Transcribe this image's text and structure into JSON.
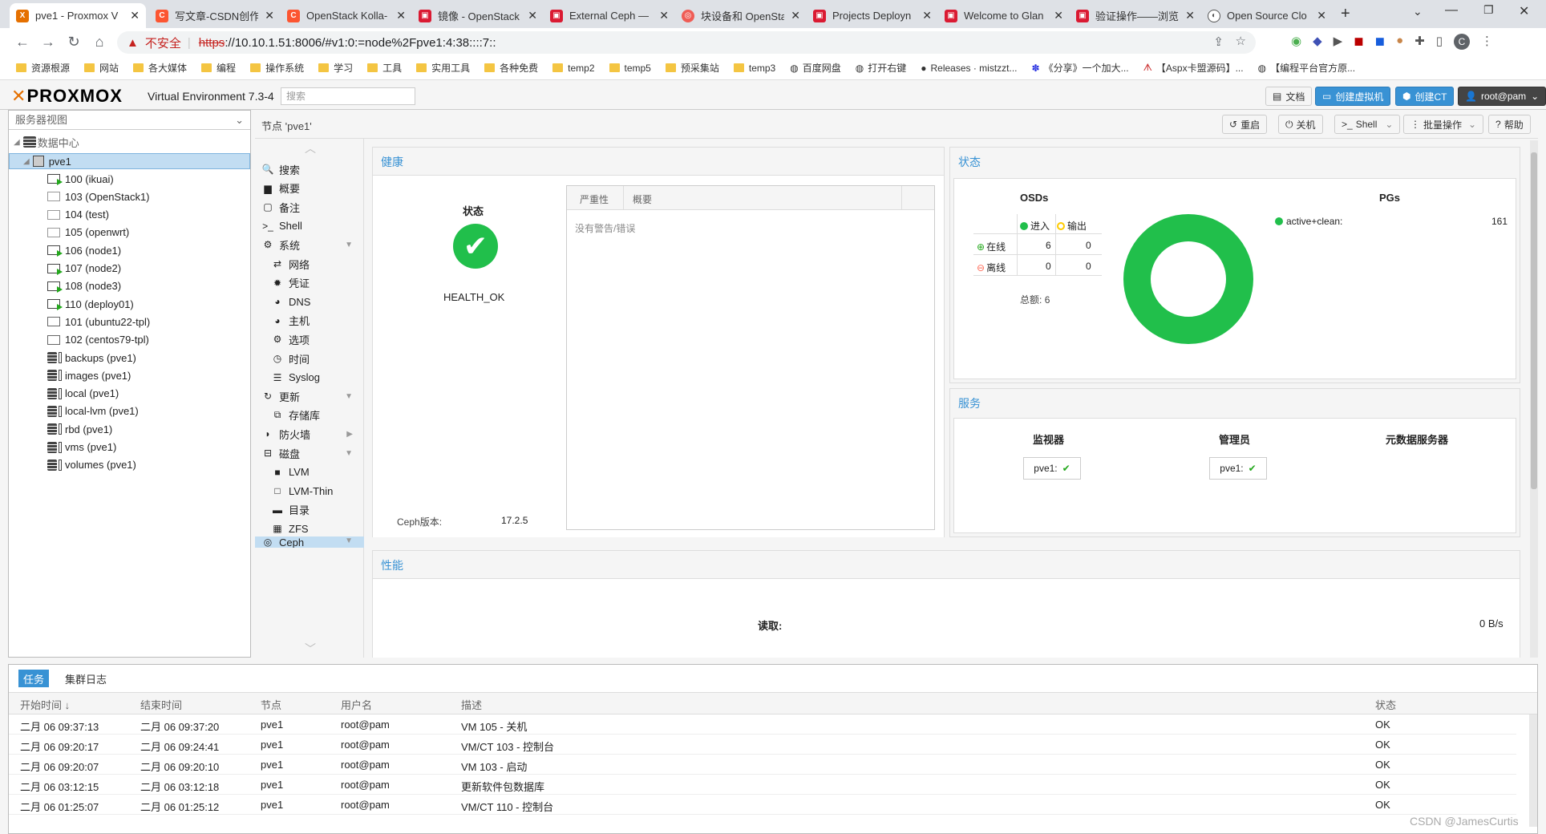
{
  "browser": {
    "tabs": [
      {
        "title": "pve1 - Proxmox V",
        "active": true,
        "icon": "proxmox-icon"
      },
      {
        "title": "写文章-CSDN创作",
        "active": false,
        "icon": "csdn-icon"
      },
      {
        "title": "OpenStack Kolla-",
        "active": false,
        "icon": "csdn-icon"
      },
      {
        "title": "镜像 - OpenStack",
        "active": false,
        "icon": "openstack-icon"
      },
      {
        "title": "External Ceph —",
        "active": false,
        "icon": "openstack-icon"
      },
      {
        "title": "块设备和 OpenSta",
        "active": false,
        "icon": "ceph-icon"
      },
      {
        "title": "Projects Deployn",
        "active": false,
        "icon": "openstack-icon"
      },
      {
        "title": "Welcome to Glan",
        "active": false,
        "icon": "openstack-icon"
      },
      {
        "title": "验证操作——浏览",
        "active": false,
        "icon": "openstack-icon"
      },
      {
        "title": "Open Source Clo",
        "active": false,
        "icon": "globe-icon"
      }
    ],
    "insecure_label": "不安全",
    "url_scheme": "https",
    "url_rest": "://10.10.1.51:8006/#v1:0:=node%2Fpve1:4:38::::7::",
    "bookmarks": [
      "资源根源",
      "网站",
      "各大媒体",
      "编程",
      "操作系统",
      "学习",
      "工具",
      "实用工具",
      "各种免费",
      "temp2",
      "temp5",
      "预采集站",
      "temp3",
      "百度网盘",
      "打开右键",
      "Releases · mistzzt...",
      "《分享》一个加大...",
      "【Aspx卡盟源码】...",
      "【编程平台官方原..."
    ]
  },
  "pve": {
    "logo": "PROXMOX",
    "version": "Virtual Environment 7.3-4",
    "search_placeholder": "搜索",
    "docs": "文档",
    "create_vm": "创建虚拟机",
    "create_ct": "创建CT",
    "user": "root@pam"
  },
  "tree": {
    "view": "服务器视图",
    "datacenter": "数据中心",
    "node": "pve1",
    "items": [
      {
        "label": "100 (ikuai)",
        "kind": "run"
      },
      {
        "label": "103 (OpenStack1)",
        "kind": "off"
      },
      {
        "label": "104 (test)",
        "kind": "off"
      },
      {
        "label": "105 (openwrt)",
        "kind": "off"
      },
      {
        "label": "106 (node1)",
        "kind": "run"
      },
      {
        "label": "107 (node2)",
        "kind": "run"
      },
      {
        "label": "108 (node3)",
        "kind": "run"
      },
      {
        "label": "110 (deploy01)",
        "kind": "run"
      },
      {
        "label": "101 (ubuntu22-tpl)",
        "kind": "tpl"
      },
      {
        "label": "102 (centos79-tpl)",
        "kind": "tpl"
      },
      {
        "label": "backups (pve1)",
        "kind": "stor"
      },
      {
        "label": "images (pve1)",
        "kind": "stor"
      },
      {
        "label": "local (pve1)",
        "kind": "stor"
      },
      {
        "label": "local-lvm (pve1)",
        "kind": "stor"
      },
      {
        "label": "rbd (pve1)",
        "kind": "stor"
      },
      {
        "label": "vms (pve1)",
        "kind": "stor"
      },
      {
        "label": "volumes (pve1)",
        "kind": "stor"
      }
    ]
  },
  "content": {
    "breadcrumb": "节点 'pve1'",
    "reboot": "重启",
    "shutdown": "关机",
    "shell": "Shell",
    "bulk": "批量操作",
    "help": "帮助"
  },
  "nav": [
    {
      "label": "搜索",
      "icon": "search-icon",
      "indent": false
    },
    {
      "label": "概要",
      "icon": "book-icon",
      "indent": false
    },
    {
      "label": "备注",
      "icon": "note-icon",
      "indent": false
    },
    {
      "label": "Shell",
      "icon": "terminal-icon",
      "indent": false
    },
    {
      "label": "系统",
      "icon": "gears-icon",
      "indent": false,
      "arrow": "down"
    },
    {
      "label": "网络",
      "icon": "network-icon",
      "indent": true
    },
    {
      "label": "凭证",
      "icon": "certificate-icon",
      "indent": true
    },
    {
      "label": "DNS",
      "icon": "globe-icon",
      "indent": true
    },
    {
      "label": "主机",
      "icon": "globe-icon",
      "indent": true
    },
    {
      "label": "选项",
      "icon": "gear-icon",
      "indent": true
    },
    {
      "label": "时间",
      "icon": "clock-icon",
      "indent": true
    },
    {
      "label": "Syslog",
      "icon": "list-icon",
      "indent": true
    },
    {
      "label": "更新",
      "icon": "refresh-icon",
      "indent": false,
      "arrow": "down"
    },
    {
      "label": "存储库",
      "icon": "files-icon",
      "indent": true
    },
    {
      "label": "防火墙",
      "icon": "shield-icon",
      "indent": false,
      "arrow": "right"
    },
    {
      "label": "磁盘",
      "icon": "hdd-icon",
      "indent": false,
      "arrow": "down"
    },
    {
      "label": "LVM",
      "icon": "square-icon",
      "indent": true
    },
    {
      "label": "LVM-Thin",
      "icon": "square-outline-icon",
      "indent": true
    },
    {
      "label": "目录",
      "icon": "folder-icon",
      "indent": true
    },
    {
      "label": "ZFS",
      "icon": "th-large-icon",
      "indent": true
    },
    {
      "label": "Ceph",
      "icon": "ceph-icon",
      "indent": false,
      "arrow": "down"
    }
  ],
  "health": {
    "title": "健康",
    "status_label": "状态",
    "status": "HEALTH_OK",
    "ceph_version_label": "Ceph版本:",
    "ceph_version": "17.2.5",
    "col_severity": "严重性",
    "col_summary": "概要",
    "empty": "没有警告/错误"
  },
  "status": {
    "title": "状态",
    "osds_title": "OSDs",
    "in_label": "进入",
    "out_label": "输出",
    "up_label": "在线",
    "down_label": "离线",
    "up_in": "6",
    "up_out": "0",
    "down_in": "0",
    "down_out": "0",
    "total_label": "总额:",
    "total": "6",
    "pgs_title": "PGs",
    "pg_state": "active+clean:",
    "pg_count": "161",
    "colors": {
      "green": "#21bf4b",
      "yellow": "#ffcc00",
      "red": "#ff6c59"
    }
  },
  "services": {
    "title": "服务",
    "monitors": "监视器",
    "managers": "管理员",
    "mds": "元数据服务器",
    "mon_item": "pve1:",
    "mgr_item": "pve1:"
  },
  "perf": {
    "title": "性能",
    "read_label": "读取:",
    "read_value": "0 B/s"
  },
  "tasks": {
    "tab_tasks": "任务",
    "tab_log": "集群日志",
    "cols": [
      "开始时间 ↓",
      "结束时间",
      "节点",
      "用户名",
      "描述",
      "状态"
    ],
    "rows": [
      [
        "二月 06 09:37:13",
        "二月 06 09:37:20",
        "pve1",
        "root@pam",
        "VM 105 - 关机",
        "OK"
      ],
      [
        "二月 06 09:20:17",
        "二月 06 09:24:41",
        "pve1",
        "root@pam",
        "VM/CT 103 - 控制台",
        "OK"
      ],
      [
        "二月 06 09:20:07",
        "二月 06 09:20:10",
        "pve1",
        "root@pam",
        "VM 103 - 启动",
        "OK"
      ],
      [
        "二月 06 03:12:15",
        "二月 06 03:12:18",
        "pve1",
        "root@pam",
        "更新软件包数据库",
        "OK"
      ],
      [
        "二月 06 01:25:07",
        "二月 06 01:25:12",
        "pve1",
        "root@pam",
        "VM/CT 110 - 控制台",
        "OK"
      ]
    ]
  },
  "watermark": "CSDN @JamesCurtis"
}
